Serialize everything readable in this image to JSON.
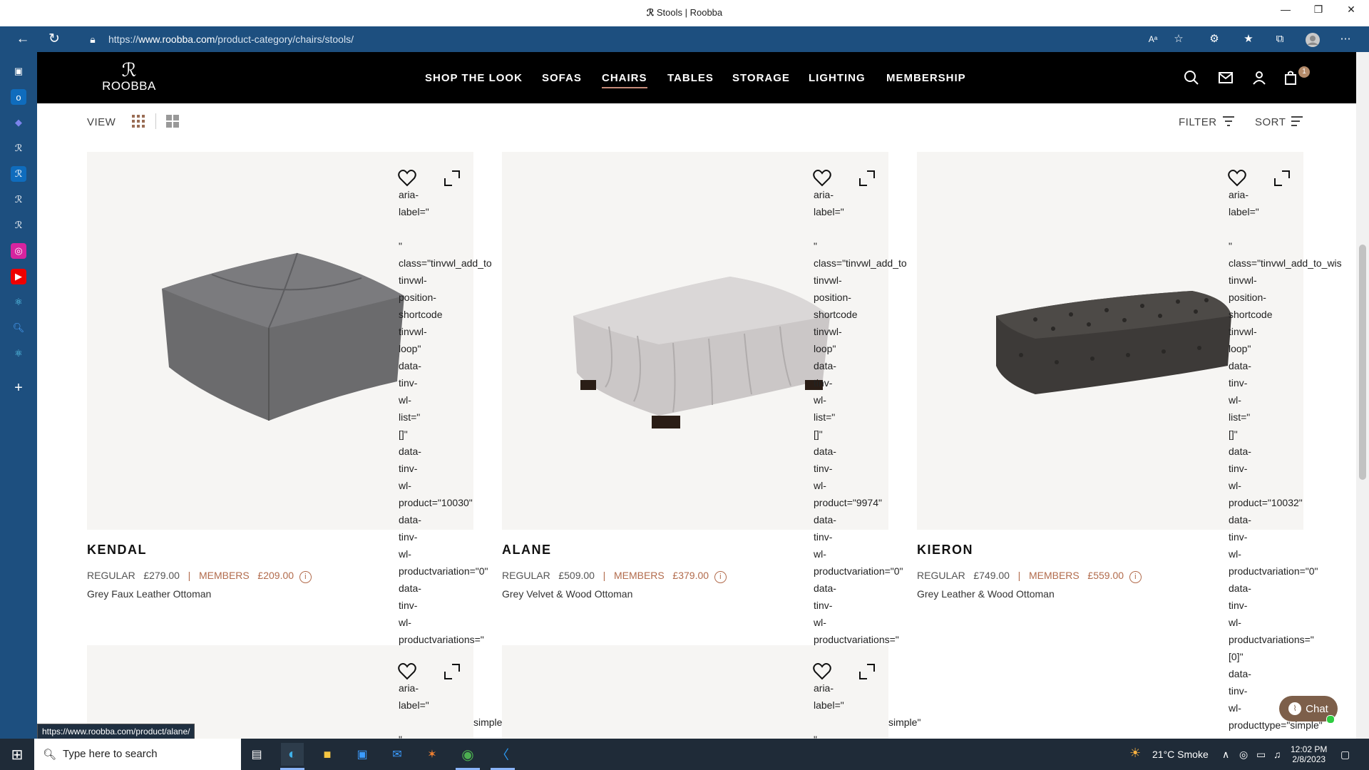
{
  "browser": {
    "tab_title": "Stools | Roobba",
    "url_prefix": "https://",
    "url_domain": "www.roobba.com",
    "url_path": "/product-category/chairs/stools/",
    "status_url": "https://www.roobba.com/product/alane/"
  },
  "site": {
    "logo_mark": "ℛ",
    "logo_name": "ROOBBA",
    "nav": [
      "SHOP THE LOOK",
      "SOFAS",
      "CHAIRS",
      "TABLES",
      "STORAGE",
      "LIGHTING",
      "MEMBERSHIP"
    ],
    "active_nav": "CHAIRS",
    "cart_count": "1"
  },
  "toolbar": {
    "view_label": "VIEW",
    "filter_label": "FILTER",
    "sort_label": "SORT"
  },
  "products": [
    {
      "name": "KENDAL",
      "regular_label": "REGULAR",
      "regular_price": "£279.00",
      "separator": "|",
      "members_label": "MEMBERS",
      "members_price": "£209.00",
      "description": "Grey Faux Leather Ottoman",
      "leak_text": "aria-\nlabel=\"\n\n\"\nclass=\"tinvwl_add_to\ntinvwl-\nposition-\nshortcode\ntinvwl-\nloop\"\ndata-\ntinv-\nwl-\nlist=\"\n[]\"\ndata-\ntinv-\nwl-\nproduct=\"10030\"\ndata-\ntinv-\nwl-\nproductvariation=\"0\"\ndata-\ntinv-\nwl-\nproductvariations=\""
    },
    {
      "name": "ALANE",
      "regular_label": "REGULAR",
      "regular_price": "£509.00",
      "separator": "|",
      "members_label": "MEMBERS",
      "members_price": "£379.00",
      "description": "Grey Velvet & Wood Ottoman",
      "leak_text": "aria-\nlabel=\"\n\n\"\nclass=\"tinvwl_add_to\ntinvwl-\nposition-\nshortcode\ntinvwl-\nloop\"\ndata-\ntinv-\nwl-\nlist=\"\n[]\"\ndata-\ntinv-\nwl-\nproduct=\"9974\"\ndata-\ntinv-\nwl-\nproductvariation=\"0\"\ndata-\ntinv-\nwl-\nproductvariations=\""
    },
    {
      "name": "KIERON",
      "regular_label": "REGULAR",
      "regular_price": "£749.00",
      "separator": "|",
      "members_label": "MEMBERS",
      "members_price": "£559.00",
      "description": "Grey Leather & Wood Ottoman",
      "leak_text": "aria-\nlabel=\"\n\n\"\nclass=\"tinvwl_add_to_wis\ntinvwl-\nposition-\nshortcode\ntinvwl-\nloop\"\ndata-\ntinv-\nwl-\nlist=\"\n[]\"\ndata-\ntinv-\nwl-\nproduct=\"10032\"\ndata-\ntinv-\nwl-\nproductvariation=\"0\"\ndata-\ntinv-\nwl-\nproductvariations=\"\n[0]\"\ndata-\ntinv-\nwl-\nproducttype=\"simple\""
    }
  ],
  "row2": {
    "leak_top": "aria-\nlabel=\"\n\n\"",
    "simple_left": "simple",
    "simple_mid": "simple\""
  },
  "chat": {
    "label": "Chat"
  },
  "taskbar": {
    "search_placeholder": "Type here to search",
    "weather": "21°C  Smoke",
    "time": "12:02 PM",
    "date": "2/8/2023"
  }
}
